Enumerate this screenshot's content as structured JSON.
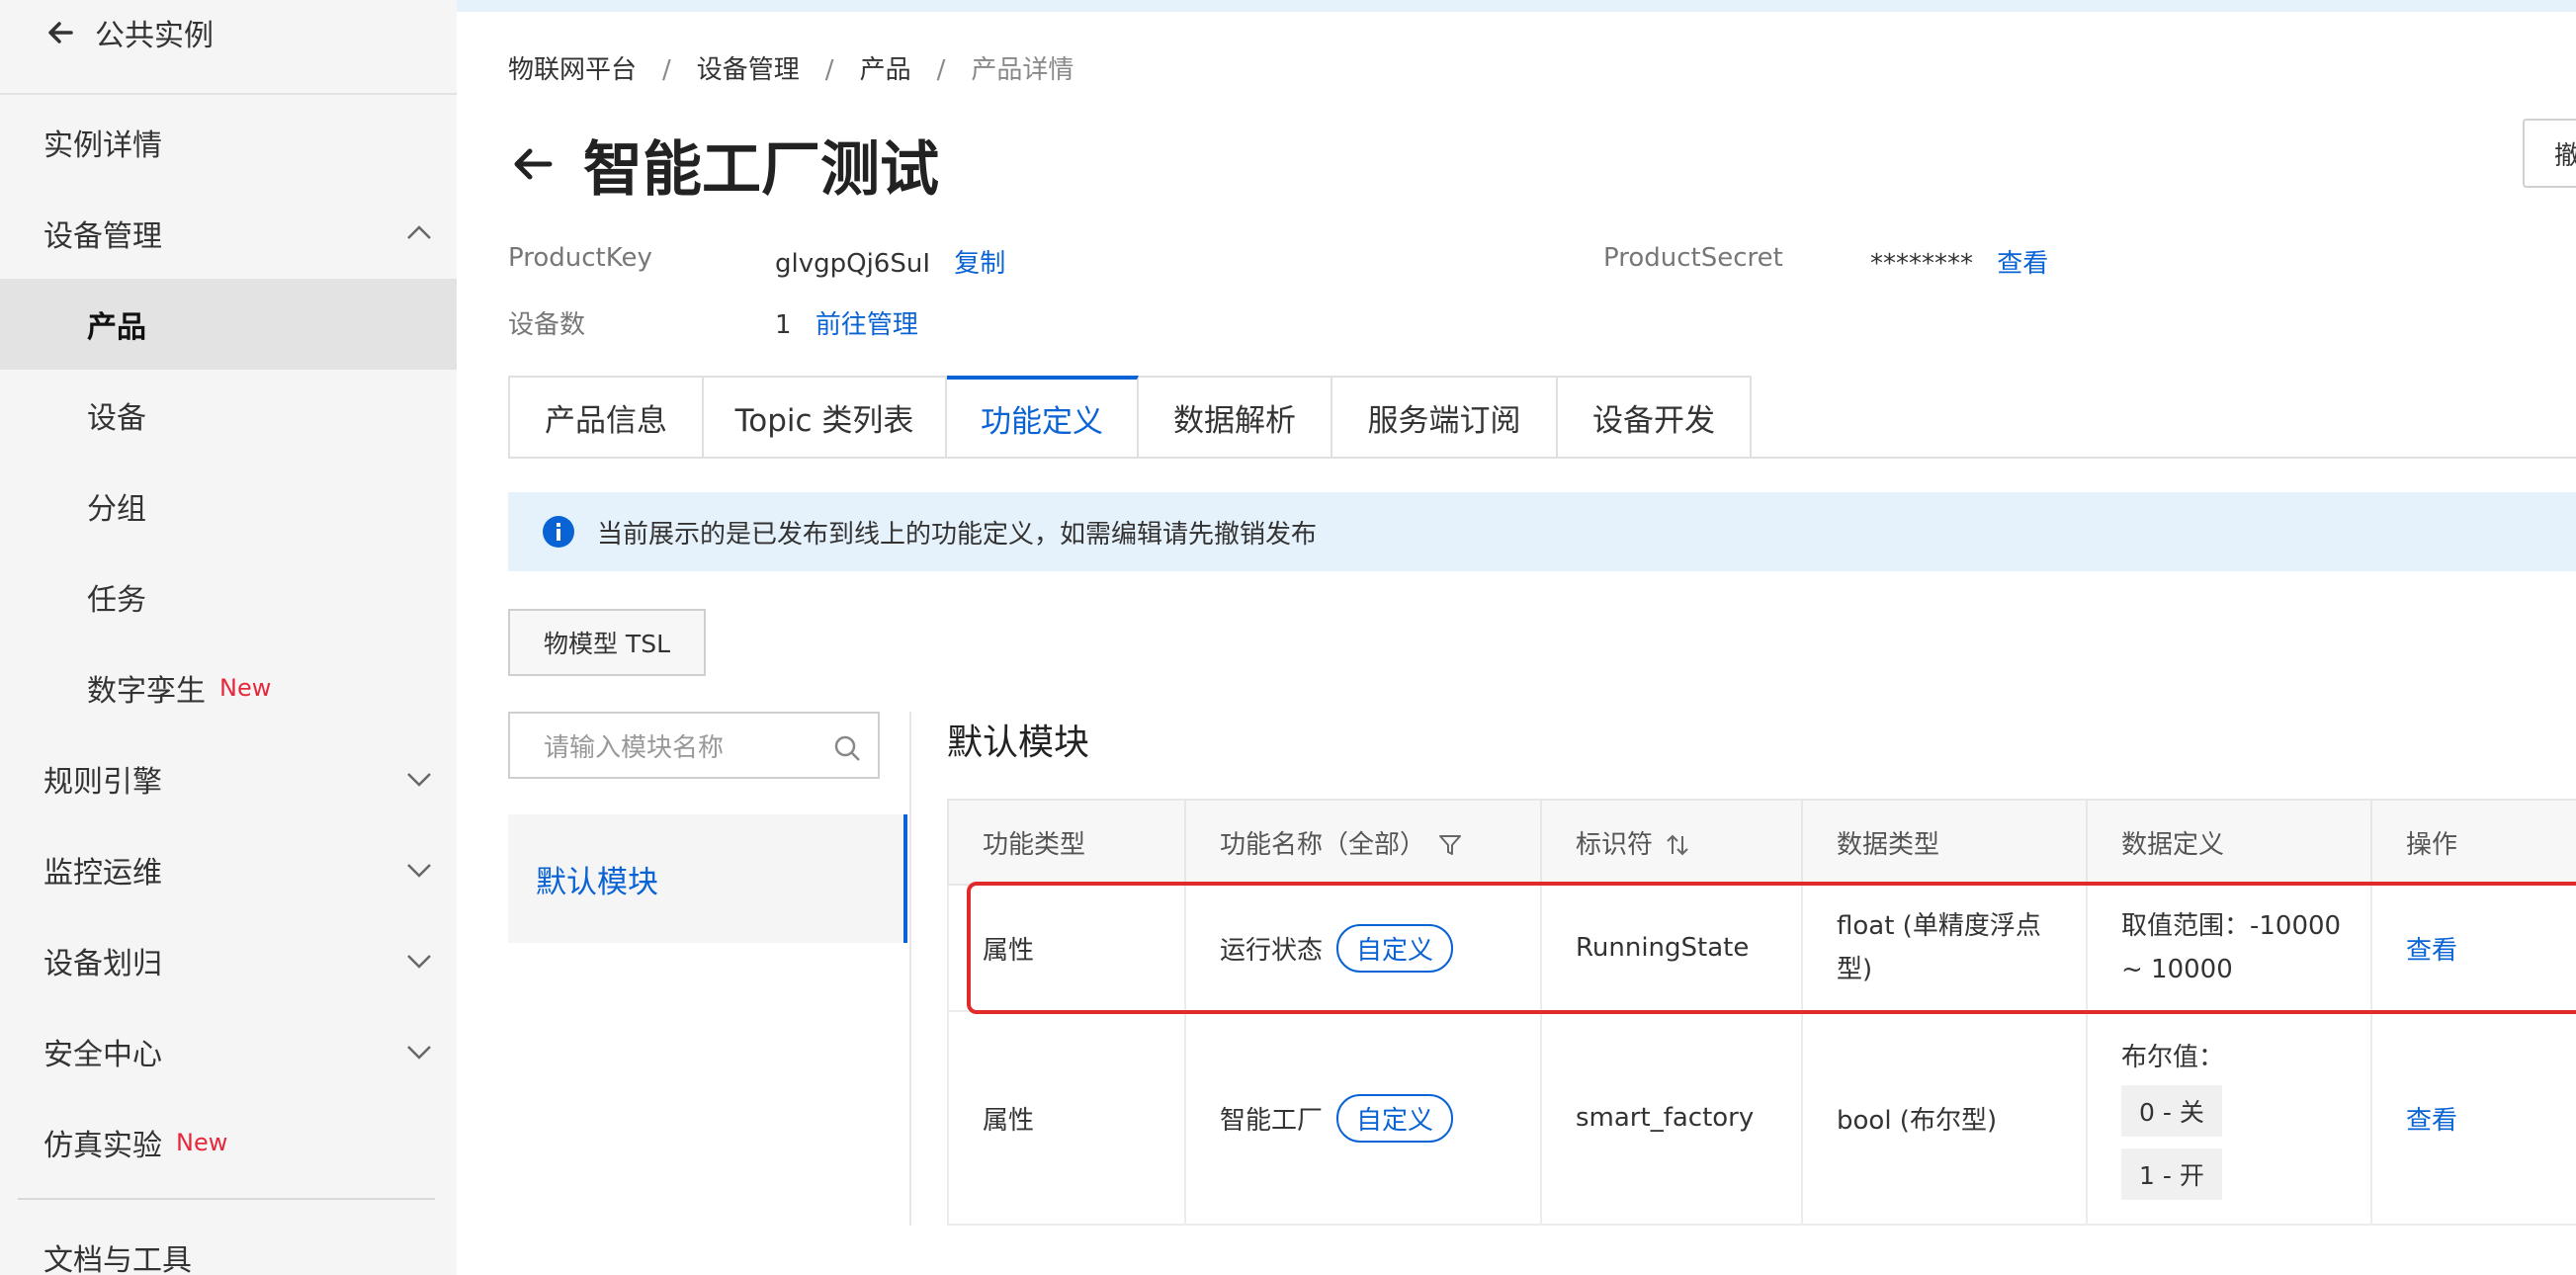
{
  "sidebar": {
    "back_label": "公共实例",
    "items": [
      {
        "label": "实例详情"
      },
      {
        "label": "设备管理"
      },
      {
        "label": "产品"
      },
      {
        "label": "设备"
      },
      {
        "label": "分组"
      },
      {
        "label": "任务"
      },
      {
        "label": "数字孪生",
        "badge": "New"
      },
      {
        "label": "规则引擎"
      },
      {
        "label": "监控运维"
      },
      {
        "label": "设备划归"
      },
      {
        "label": "安全中心"
      },
      {
        "label": "仿真实验",
        "badge": "New"
      },
      {
        "label": "文档与工具"
      }
    ]
  },
  "breadcrumb": [
    "物联网平台",
    "设备管理",
    "产品",
    "产品详情"
  ],
  "breadcrumb_sep": "/",
  "page_title": "智能工厂测试",
  "cut_button_label": "撤",
  "info": {
    "product_key_label": "ProductKey",
    "product_key_value": "glvgpQj6SuI",
    "copy_link": "复制",
    "product_secret_label": "ProductSecret",
    "product_secret_value": "********",
    "view_link": "查看",
    "device_count_label": "设备数",
    "device_count_value": "1",
    "manage_link": "前往管理"
  },
  "tabs": [
    {
      "label": "产品信息"
    },
    {
      "label": "Topic 类列表"
    },
    {
      "label": "功能定义"
    },
    {
      "label": "数据解析"
    },
    {
      "label": "服务端订阅"
    },
    {
      "label": "设备开发"
    }
  ],
  "notice_text": "当前展示的是已发布到线上的功能定义，如需编辑请先撤销发布",
  "tsl_button": "物模型 TSL",
  "search_placeholder": "请输入模块名称",
  "module_list": [
    "默认模块"
  ],
  "module_title": "默认模块",
  "table": {
    "headers": [
      "功能类型",
      "功能名称（全部）",
      "标识符",
      "数据类型",
      "数据定义",
      "操作"
    ],
    "rows": [
      {
        "type": "属性",
        "name": "运行状态",
        "tag": "自定义",
        "identifier": "RunningState",
        "data_type": "float (单精度浮点型)",
        "definition": "取值范围：-10000 ~ 10000",
        "action": "查看"
      },
      {
        "type": "属性",
        "name": "智能工厂",
        "tag": "自定义",
        "identifier": "smart_factory",
        "data_type": "bool (布尔型)",
        "definition_label": "布尔值：",
        "bool_values": [
          "0 - 关",
          "1 - 开"
        ],
        "action": "查看"
      }
    ]
  },
  "colors": {
    "accent": "#0a63d4",
    "highlight_box": "#e12a2a",
    "badge_new": "#e5293c"
  }
}
